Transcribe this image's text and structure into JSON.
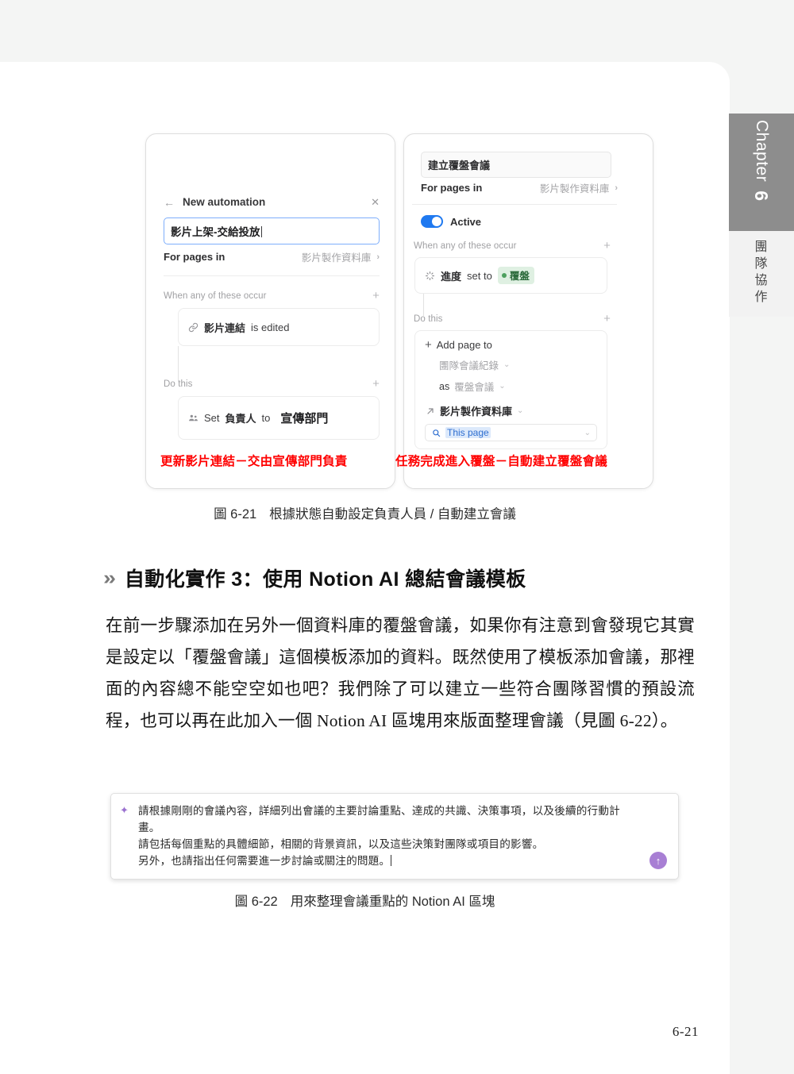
{
  "chapter_tab": {
    "label": "Chapter",
    "number": "6",
    "subtitle_chars": [
      "團",
      "隊",
      "協",
      "作"
    ]
  },
  "figure_21": {
    "caption_number": "圖 6-21",
    "caption_text": "根據狀態自動設定負責人員 / 自動建立會議",
    "left_card": {
      "back_icon": "back-arrow-icon",
      "header_title": "New automation",
      "close_icon": "close-icon",
      "name_input_value": "影片上架-交給投放",
      "for_pages_in_label": "For pages in",
      "for_pages_in_value": "影片製作資料庫",
      "trigger_section_label": "When any of these occur",
      "trigger_icon": "link-icon",
      "trigger_property": "影片連結",
      "trigger_verb": "is edited",
      "action_section_label": "Do this",
      "action_icon": "people-icon",
      "action_verb": "Set",
      "action_property": "負責人",
      "action_to": "to",
      "action_value": "宣傳部門",
      "red_note": "更新影片連結－交由宣傳部門負責"
    },
    "right_card": {
      "name_input_value": "建立覆盤會議",
      "for_pages_in_label": "For pages in",
      "for_pages_in_value": "影片製作資料庫",
      "active_toggle_label": "Active",
      "active_toggle_on": true,
      "trigger_section_label": "When any of these occur",
      "trigger_icon": "status-spinner-icon",
      "trigger_property": "進度",
      "trigger_verb": "set to",
      "trigger_status_value": "覆盤",
      "action_section_label": "Do this",
      "add_page_to_label": "Add page to",
      "add_page_target": "團隊會議紀錄",
      "as_label": "as",
      "as_value": "覆盤會議",
      "relation_icon": "arrow-up-right-icon",
      "relation_value": "影片製作資料庫",
      "search_icon": "search-icon",
      "search_value": "This page",
      "red_note": "任務完成進入覆盤－自動建立覆盤會議"
    }
  },
  "heading_3": {
    "marker": "»",
    "text": "自動化實作 3：使用 Notion AI 總結會議模板"
  },
  "body_paragraph": "在前一步驟添加在另外一個資料庫的覆盤會議，如果你有注意到會發現它其實是設定以「覆盤會議」這個模板添加的資料。既然使用了模板添加會議，那裡面的內容總不能空空如也吧？我們除了可以建立一些符合團隊習慣的預設流程，也可以再在此加入一個 Notion AI 區塊用來版面整理會議（見圖 6-22）。",
  "ai_block": {
    "sparkle_icon": "ai-sparkle-icon",
    "lines": [
      "請根據剛剛的會議內容，詳細列出會議的主要討論重點、達成的共識、決策事項，以及後續的行動計",
      "畫。",
      "請包括每個重點的具體細節，相關的背景資訊，以及這些決策對團隊或項目的影響。",
      "另外，也請指出任何需要進一步討論或關注的問題。"
    ],
    "send_icon": "send-up-arrow-icon"
  },
  "figure_22": {
    "caption_number": "圖 6-22",
    "caption_text": "用來整理會議重點的 Notion AI 區塊"
  },
  "page_number": "6-21",
  "colors": {
    "accent_blue": "#1f79f0",
    "annotation_red": "#ff0000",
    "ai_purple": "#a87fd4",
    "status_green_bg": "#dff0e2",
    "status_green_text": "#2d6b3c",
    "chapter_tab_gray": "#8d8d8d"
  }
}
